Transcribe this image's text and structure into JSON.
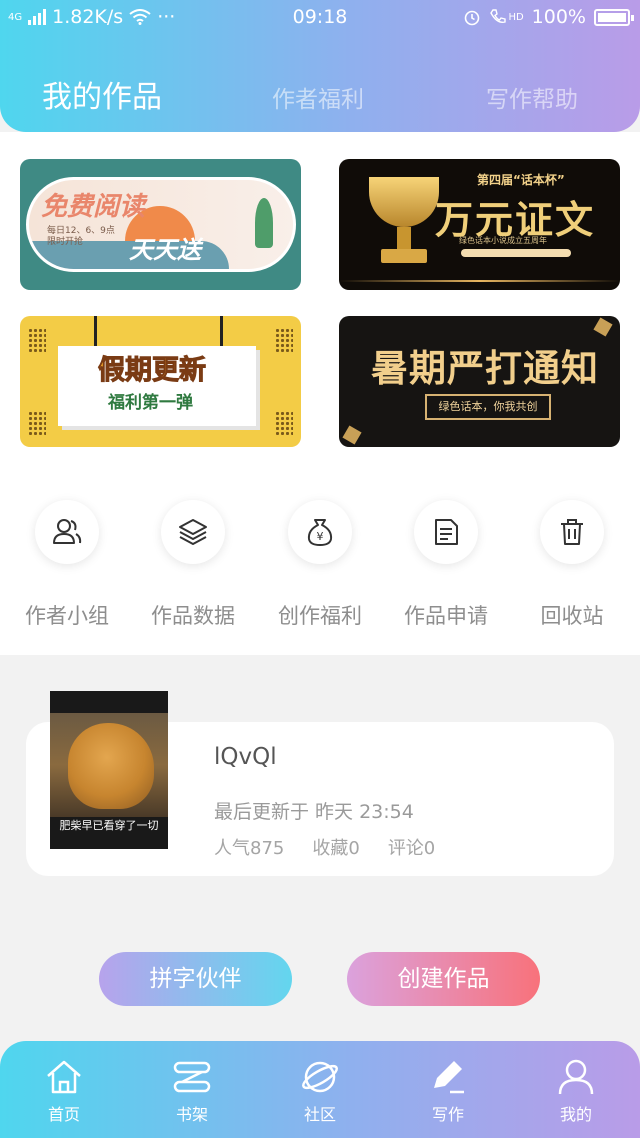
{
  "status_bar": {
    "network": "4G",
    "speed": "1.82K/s",
    "more": "···",
    "time": "09:18",
    "hd": "HD",
    "battery": "100%"
  },
  "tabs": [
    {
      "label": "我的作品",
      "active": true
    },
    {
      "label": "作者福利",
      "active": false
    },
    {
      "label": "写作帮助",
      "active": false
    }
  ],
  "banners": [
    {
      "title": "免费阅读",
      "subtitle": "天天送",
      "note": "每日12、6、9点\n限时开抢"
    },
    {
      "title": "万元证文",
      "kicker": "第四届“话本杯”",
      "note": "绿色话本小说成立五周年"
    },
    {
      "title": "假期更新",
      "subtitle": "福利第一弹"
    },
    {
      "title": "暑期严打通知",
      "subtitle": "绿色话本，你我共创"
    }
  ],
  "quick_actions": [
    {
      "label": "作者小组",
      "icon": "users-icon"
    },
    {
      "label": "作品数据",
      "icon": "layers-icon"
    },
    {
      "label": "创作福利",
      "icon": "money-bag-icon"
    },
    {
      "label": "作品申请",
      "icon": "document-icon"
    },
    {
      "label": "回收站",
      "icon": "trash-icon"
    }
  ],
  "work": {
    "cover_caption": "肥柴早已看穿了一切",
    "title": "lQvQl",
    "updated": "最后更新于 昨天 23:54",
    "popularity": "人气875",
    "favorites": "收藏0",
    "comments": "评论0"
  },
  "buttons": {
    "partner": "拼字伙伴",
    "create": "创建作品"
  },
  "nav": [
    {
      "label": "首页",
      "icon": "home-icon"
    },
    {
      "label": "书架",
      "icon": "bookshelf-icon"
    },
    {
      "label": "社区",
      "icon": "planet-icon"
    },
    {
      "label": "写作",
      "icon": "pen-icon",
      "active": true
    },
    {
      "label": "我的",
      "icon": "user-icon"
    }
  ],
  "colors": {
    "gradient_start": "#4fd6ee",
    "gradient_end": "#b99ce8",
    "create_button_end": "#f8727b"
  }
}
